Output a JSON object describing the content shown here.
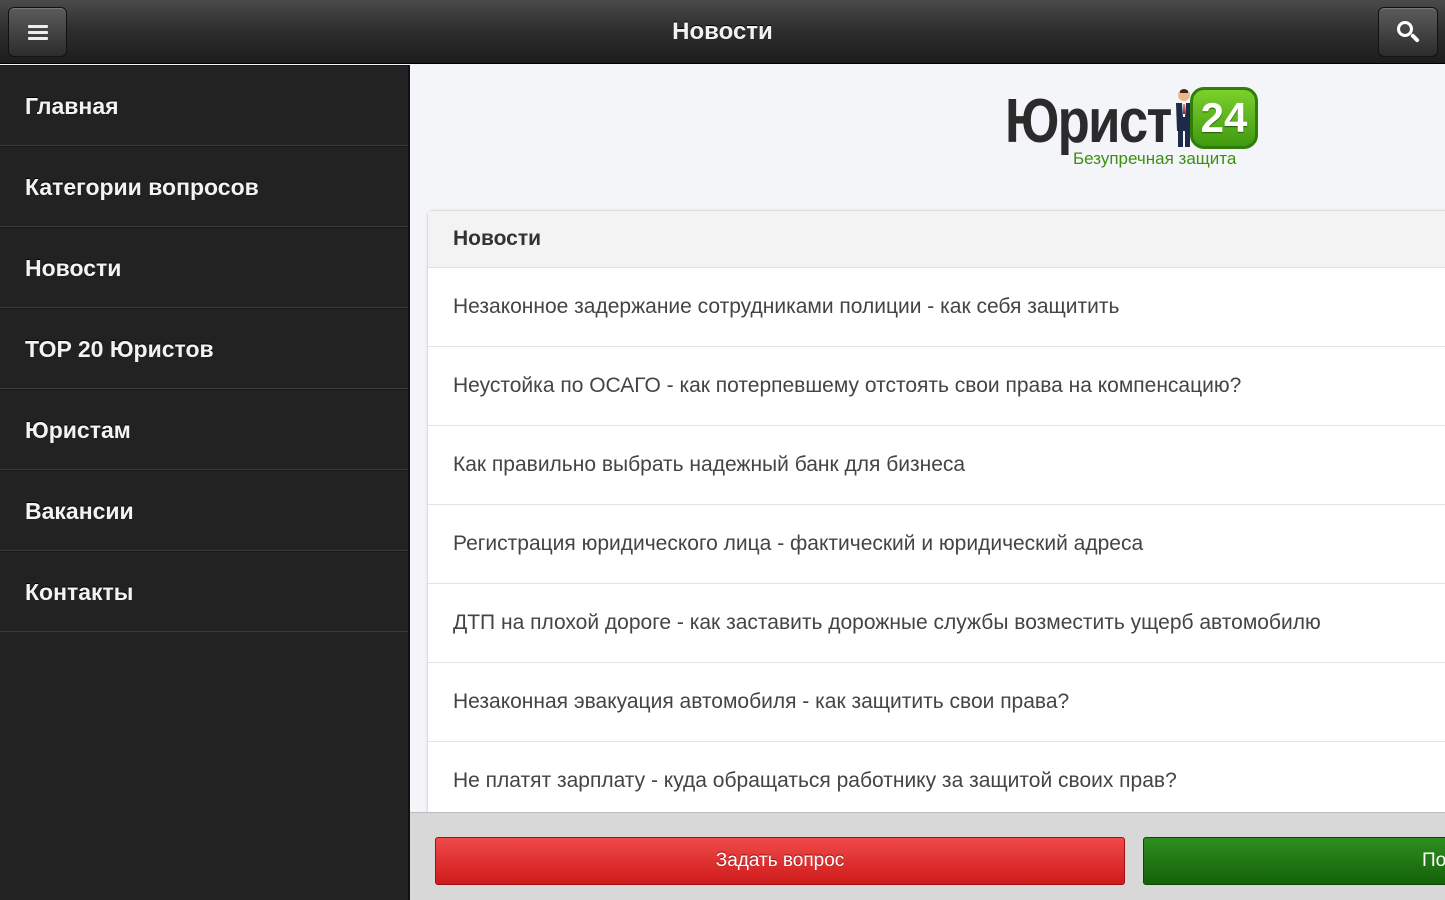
{
  "header": {
    "title": "Новости",
    "menu_icon": "hamburger-menu-icon",
    "search_icon": "search-icon"
  },
  "sidebar": {
    "items": [
      {
        "label": "Главная"
      },
      {
        "label": "Категории вопросов"
      },
      {
        "label": "Новости"
      },
      {
        "label": "TOP 20 Юристов"
      },
      {
        "label": "Юристам"
      },
      {
        "label": "Вакансии"
      },
      {
        "label": "Контакты"
      }
    ]
  },
  "logo": {
    "word": "Юрист",
    "badge": "24",
    "tagline": "Безупречная защита",
    "colors": {
      "badge": "#4fae1a",
      "tagline": "#3c8f13"
    }
  },
  "news": {
    "heading": "Новости",
    "items": [
      {
        "title": "Незаконное задержание сотрудниками полиции - как себя защитить"
      },
      {
        "title": "Неустойка по ОСАГО - как потерпевшему отстоять свои права на компенсацию?"
      },
      {
        "title": "Как правильно выбрать надежный банк для бизнеса"
      },
      {
        "title": "Регистрация юридического лица - фактический и юридический адреса"
      },
      {
        "title": "ДТП на плохой дороге - как заставить дорожные службы возместить ущерб автомобилю"
      },
      {
        "title": "Незаконная эвакуация автомобиля - как защитить свои права?"
      },
      {
        "title": "Не платят зарплату - куда обращаться работнику за защитой своих прав?"
      }
    ]
  },
  "footer": {
    "ask_label": "Задать вопрос",
    "second_label": "По",
    "colors": {
      "ask": "#e03030",
      "second": "#1f7512"
    }
  }
}
